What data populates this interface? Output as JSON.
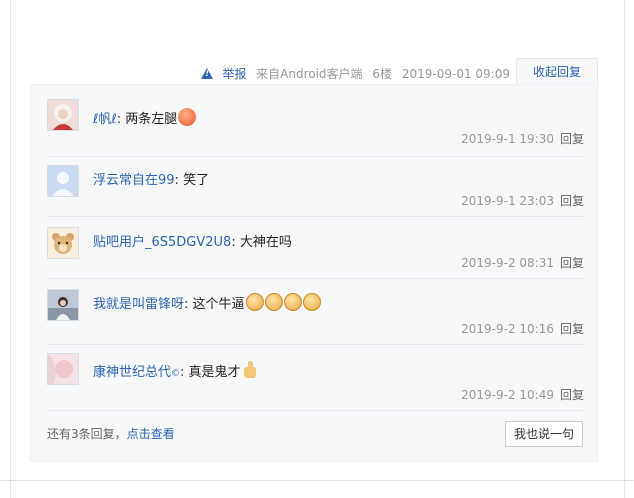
{
  "post_meta": {
    "report_label": "举报",
    "source": "来自Android客户端",
    "floor": "6楼",
    "datetime": "2019-09-01 09:09",
    "collapse_label": "收起回复"
  },
  "replies": [
    {
      "username": "ℓ帆ℓ",
      "text": "两条左腿",
      "emoji": "red-face-emoji",
      "time": "2019-9-1 19:30",
      "reply_label": "回复",
      "avatar": "avatar-girl-white-hair"
    },
    {
      "username": "浮云常自在99",
      "text": "笑了",
      "emoji": "",
      "time": "2019-9-1 23:03",
      "reply_label": "回复",
      "avatar": "avatar-default-user"
    },
    {
      "username": "贴吧用户_6S5DGV2U8",
      "text": "大神在吗",
      "emoji": "",
      "time": "2019-9-2 08:31",
      "reply_label": "回复",
      "avatar": "avatar-bear"
    },
    {
      "username": "我就是叫雷锋呀",
      "text": "这个牛逼",
      "emoji": "angry-face-emoji x4",
      "time": "2019-9-2 10:16",
      "reply_label": "回复",
      "avatar": "avatar-girl-photo"
    },
    {
      "username": "康神世纪总代",
      "badge": "©",
      "text": "真是鬼才",
      "emoji": "thumbs-up-emoji",
      "time": "2019-9-2 10:49",
      "reply_label": "回复",
      "avatar": "avatar-pink-girl"
    }
  ],
  "footer": {
    "more_text": "还有3条回复，",
    "more_link": "点击查看",
    "say_button": "我也说一句"
  }
}
